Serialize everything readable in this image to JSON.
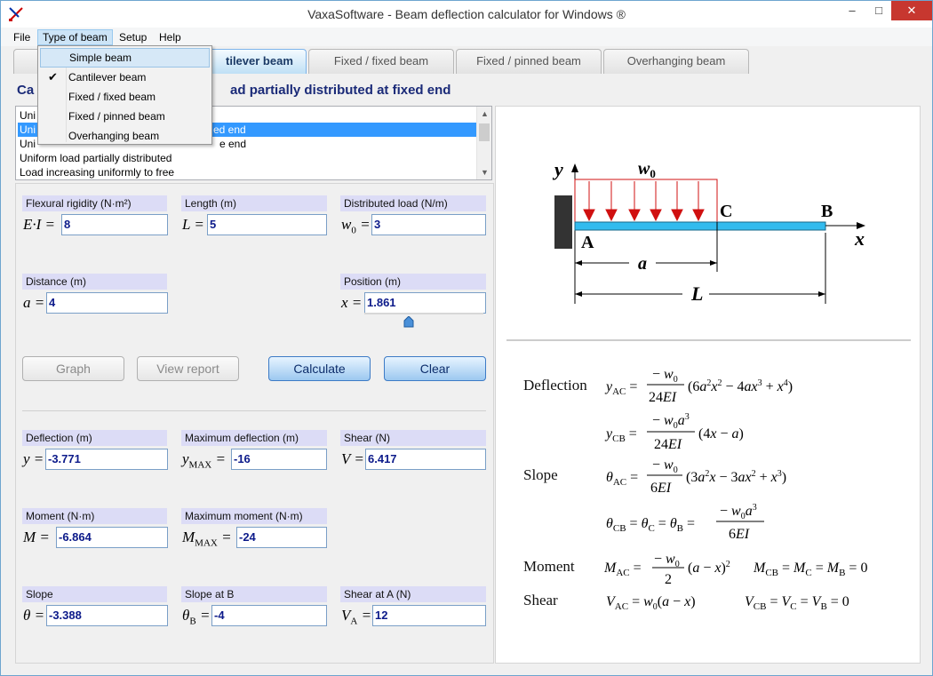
{
  "window": {
    "title": "VaxaSoftware - Beam deflection calculator for Windows ®"
  },
  "title_buttons": {
    "minimize": "–",
    "maximize": "□",
    "close": "✕"
  },
  "menu": {
    "file": "File",
    "type_of_beam": "Type of beam",
    "setup": "Setup",
    "help": "Help"
  },
  "dropdown": {
    "items": [
      "Simple beam",
      "Cantilever beam",
      "Fixed / fixed beam",
      "Fixed / pinned beam",
      "Overhanging beam"
    ],
    "checked": "✔"
  },
  "tabs": [
    "Simple beam",
    "Cantilever beam",
    "Fixed / fixed beam",
    "Fixed / pinned beam",
    "Overhanging beam"
  ],
  "tab_visible": {
    "cantilever": "tilever beam"
  },
  "heading": "Ca                                                     ad partially distributed at fixed end",
  "load_cases": [
    {
      "left": "Uni",
      "right": ""
    },
    {
      "left": "Uni",
      "right": "ed end"
    },
    {
      "left": "Uni",
      "right": "e end"
    },
    {
      "left": "Uniform load partially distributed",
      "right": ""
    },
    {
      "left": "Load increasing uniformly to free",
      "right": ""
    }
  ],
  "inputs": {
    "flexural_rigidity": {
      "label": "Flexural rigidity (N·m²)",
      "symbol": "E·I =",
      "value": "8"
    },
    "length": {
      "label": "Length (m)",
      "symbol": "L =",
      "value": "5"
    },
    "distributed_load": {
      "label": "Distributed load (N/m)",
      "symbol": "w",
      "symbol_sub": "0",
      "symbol_eq": "=",
      "value": "3"
    },
    "distance": {
      "label": "Distance (m)",
      "symbol": "a =",
      "value": "4"
    },
    "position": {
      "label": "Position (m)",
      "symbol": "x =",
      "value": "1.861"
    },
    "position_slider_fraction": 0.372
  },
  "buttons": {
    "graph": "Graph",
    "view_report": "View report",
    "calculate": "Calculate",
    "clear": "Clear"
  },
  "outputs": {
    "deflection": {
      "label": "Deflection (m)",
      "symbol": "y =",
      "value": "-3.771"
    },
    "max_deflection": {
      "label": "Maximum deflection (m)",
      "symbol": "y",
      "symbol_sub": "MAX",
      "symbol_eq": "=",
      "value": "-16"
    },
    "shear": {
      "label": "Shear (N)",
      "symbol": "V =",
      "value": "6.417"
    },
    "moment": {
      "label": "Moment (N·m)",
      "symbol": "M =",
      "value": "-6.864"
    },
    "max_moment": {
      "label": "Maximum moment (N·m)",
      "symbol": "M",
      "symbol_sub": "MAX",
      "symbol_eq": "=",
      "value": "-24"
    },
    "slope": {
      "label": "Slope",
      "symbol": "θ =",
      "value": "-3.388"
    },
    "slope_b": {
      "label": "Slope at B",
      "symbol": "θ",
      "symbol_sub": "B",
      "symbol_eq": "=",
      "value": "-4"
    },
    "shear_a": {
      "label": "Shear at A (N)",
      "symbol": "V",
      "symbol_sub": "A",
      "symbol_eq": "=",
      "value": "12"
    }
  },
  "diagram": {
    "y_axis": "y",
    "x_axis": "x",
    "load": "w",
    "load_sub": "0",
    "point_a": "A",
    "point_b": "B",
    "point_c": "C",
    "dim_a": "a",
    "dim_l": "L"
  },
  "formulas": {
    "deflection_label": "Deflection",
    "slope_label": "Slope",
    "moment_label": "Moment",
    "shear_label": "Shear"
  },
  "colors": {
    "accent": "#3399ff",
    "heading": "#1a2a78",
    "load_arrow": "#d01010",
    "beam": "#33bbee"
  }
}
